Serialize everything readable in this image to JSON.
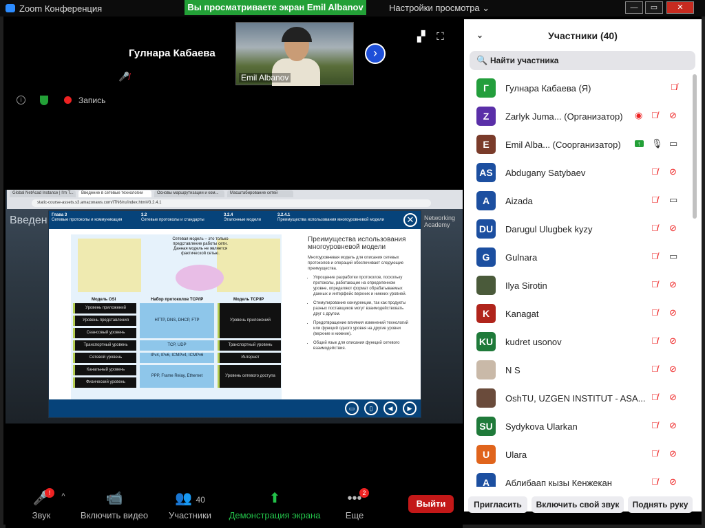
{
  "app": {
    "title": "Zoom Конференция",
    "viewing_banner": "Вы просматриваете экран Emil Albanov",
    "view_options": "Настройки просмотра ⌄"
  },
  "window": {
    "minimize": "—",
    "maximize": "▭",
    "close": "✕"
  },
  "stage": {
    "speaker_name": "Гулнара Кабаева",
    "thumbnail_name": "Emil Albanov",
    "recording_label": "Запись"
  },
  "shared": {
    "intro_word": "Введен",
    "academy": [
      "Networking",
      "Academy"
    ],
    "tabs": [
      "Global NetAcad Instance | I'm T...",
      "Введение в сетевые технологии",
      "Основы маршрутизации и ком...",
      "Масштабирование сетей"
    ],
    "url": "static-course-assets.s3.amazonaws.com/ITN6/ru/index.html#3.2.4.1",
    "crumbs": [
      {
        "num": "Глава 3",
        "text": "Сетевые протоколы и коммуникация"
      },
      {
        "num": "3.2",
        "text": "Сетевые протоколы и стандарты"
      },
      {
        "num": "3.2.4",
        "text": "Эталонные модели"
      },
      {
        "num": "3.2.4.1",
        "text": "Преимущества использования многоуровневой модели"
      }
    ],
    "diagram_caption": "Сетевая модель – это только представление работы сети. Данная модель не является фактической сетью.",
    "col_osi": "Модель OSI",
    "col_suite": "Набор протоколов TCP/IP",
    "col_tcpip": "Модель TCP/IP",
    "osi_layers": [
      "Уровень приложений",
      "Уровень представления",
      "Сеансовый уровень",
      "Транспортный уровень",
      "Сетевой уровень",
      "Канальный уровень",
      "Физический уровень"
    ],
    "suite_rows": [
      "HTTP, DNS, DHCP, FTP",
      "TCP, UDP",
      "IPv4, IPv6, ICMPv4, ICMPv6",
      "PPP, Frame Relay, Ethernet"
    ],
    "tcpip_layers": [
      "Уровень приложений",
      "Транспортный уровень",
      "Интернет",
      "Уровень сетевого доступа"
    ],
    "side_title": "Преимущества использования многоуровневой модели",
    "side_intro": "Многоуровневая модель для описания сетевых протоколов и операций обеспечивает следующие преимущества.",
    "side_points": [
      "Упрощение разработки протоколов, поскольку протоколы, работающие на определенном уровне, определяют формат обрабатываемых данных и интерфейс верхних и нижних уровней.",
      "Стимулирование конкуренции, так как продукты разных поставщиков могут взаимодействовать друг с другом.",
      "Предотвращение влияния изменений технологий или функций одного уровня на другие уровни (верхние и нижние).",
      "Общий язык для описания функций сетевого взаимодействия."
    ]
  },
  "toolbar": {
    "audio": "Звук",
    "video": "Включить видео",
    "participants": "Участники",
    "participants_count": "40",
    "share": "Демонстрация экрана",
    "more": "Еще",
    "more_badge": "2",
    "audio_badge": "!",
    "leave": "Выйти"
  },
  "panel": {
    "title": "Участники (40)",
    "search_placeholder": "Найти участника",
    "participants": [
      {
        "initials": "Г",
        "name": "Гулнара Кабаева (Я)",
        "color": "#239e3c",
        "mic": "muted",
        "video": ""
      },
      {
        "initials": "Z",
        "name": "Zarlyk Juma...  (Организатор)",
        "color": "#5a2fa8",
        "mic": "muted",
        "video": "off",
        "rec": "◉"
      },
      {
        "initials": "E",
        "name": "Emil Alba...  (Соорганизатор)",
        "color": "#7a3b2a",
        "mic": "on",
        "video": "on",
        "share": "↑"
      },
      {
        "initials": "AS",
        "name": "Abdugany Satybaev",
        "color": "#1c4fa0",
        "mic": "muted",
        "video": "off"
      },
      {
        "initials": "A",
        "name": "Aizada",
        "color": "#1c4fa0",
        "mic": "muted",
        "video": "on"
      },
      {
        "initials": "DU",
        "name": "Darugul Ulugbek kyzy",
        "color": "#1c4fa0",
        "mic": "muted",
        "video": "off"
      },
      {
        "initials": "G",
        "name": "Gulnara",
        "color": "#1c4fa0",
        "mic": "muted",
        "video": "on"
      },
      {
        "initials": "",
        "name": "Ilya Sirotin",
        "color": "#4a5a3a",
        "mic": "muted",
        "video": "off"
      },
      {
        "initials": "K",
        "name": "Kanagat",
        "color": "#b0241b",
        "mic": "muted",
        "video": "off"
      },
      {
        "initials": "KU",
        "name": "kudret usonov",
        "color": "#1f7a3a",
        "mic": "muted",
        "video": "off"
      },
      {
        "initials": "",
        "name": "N S",
        "color": "#c9b9a8",
        "mic": "muted",
        "video": "off"
      },
      {
        "initials": "",
        "name": "OshTU, UZGEN INSTITUT - ASA...",
        "color": "#6a4b3b",
        "mic": "muted",
        "video": "off"
      },
      {
        "initials": "SU",
        "name": "Sydykova Ularkan",
        "color": "#1f7a3a",
        "mic": "muted",
        "video": "off"
      },
      {
        "initials": "U",
        "name": "Ulara",
        "color": "#e0641c",
        "mic": "muted",
        "video": "off"
      },
      {
        "initials": "A",
        "name": "Аблибаап кызы Кенжекан",
        "color": "#1c4fa0",
        "mic": "muted",
        "video": "off"
      }
    ],
    "invite": "Пригласить",
    "unmute": "Включить свой звук",
    "raise_hand": "Поднять руку"
  }
}
